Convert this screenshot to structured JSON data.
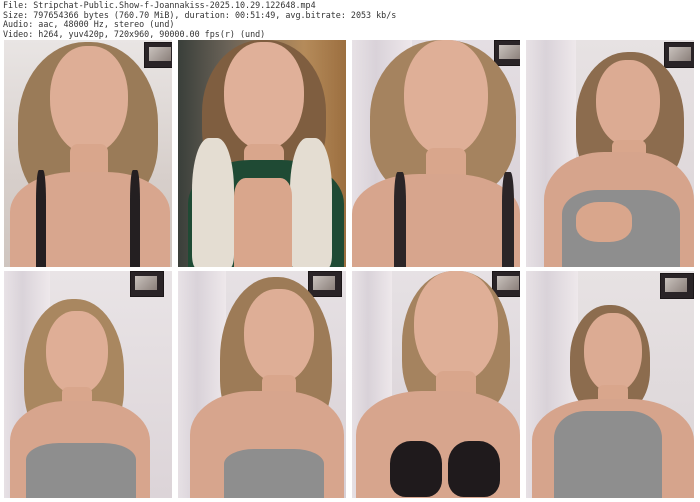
{
  "header": {
    "lines": [
      "File: Stripchat-Public.Show-f-Joannakiss-2025.10.29.122648.mp4",
      "Size: 797654366 bytes (760.70 MiB), duration: 00:51:49, avg.bitrate: 2053 kb/s",
      "Audio: aac, 48000 Hz, stereo (und)",
      "Video: h264, yuv420p, 720x960, 90000.00 fps(r) (und)"
    ]
  },
  "thumbnails": [
    {
      "scene": "bedroom-light",
      "top": "dark-camisole"
    },
    {
      "scene": "doorway-wood",
      "top": "green-robe"
    },
    {
      "scene": "bedroom-curtain",
      "top": "grey-camisole"
    },
    {
      "scene": "bedroom-wall",
      "top": "grey-camisole"
    },
    {
      "scene": "bedroom-curtain",
      "top": "grey-tank"
    },
    {
      "scene": "bedroom-curtain",
      "top": "grey-tank"
    },
    {
      "scene": "bedroom-curtain",
      "top": "black-bra"
    },
    {
      "scene": "bedroom-wall",
      "top": "grey-tank"
    }
  ],
  "colors": {
    "background": "#ffffff",
    "header_text": "#333333",
    "skin": "#d9a68c",
    "hair": "#8a6a4b",
    "grey_top": "#8e8e8e",
    "black_top": "#1f1a1c",
    "green_robe": "#1f4a34",
    "fleece": "#e4ddd2"
  }
}
